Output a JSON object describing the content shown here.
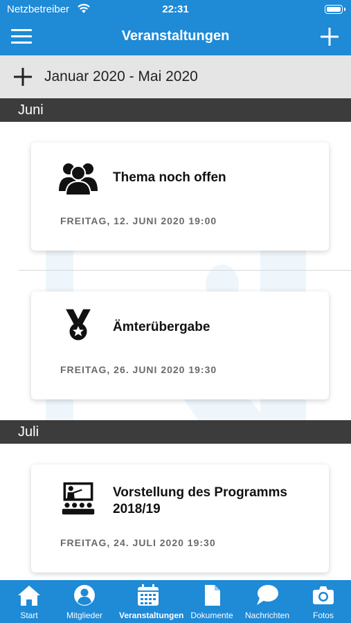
{
  "status": {
    "carrier": "Netzbetreiber",
    "time": "22:31"
  },
  "navbar": {
    "title": "Veranstaltungen"
  },
  "range": {
    "label": "Januar 2020 - Mai 2020"
  },
  "sections": [
    {
      "title": "Juni"
    },
    {
      "title": "Juli"
    }
  ],
  "events": [
    {
      "title": "Thema noch offen",
      "date": "FREITAG, 12. JUNI 2020 19:00",
      "icon": "group-icon"
    },
    {
      "title": "Ämterübergabe",
      "date": "FREITAG, 26. JUNI 2020 19:30",
      "icon": "medal-icon"
    },
    {
      "title_line1": "Vorstellung des Programms",
      "title_line2": "2018/19",
      "date": "FREITAG, 24. JULI 2020 19:30",
      "icon": "presentation-icon"
    }
  ],
  "tabs": [
    {
      "label": "Start",
      "icon": "home-icon"
    },
    {
      "label": "Mitglieder",
      "icon": "user-icon"
    },
    {
      "label": "Veranstaltungen",
      "icon": "calendar-icon",
      "active": true
    },
    {
      "label": "Dokumente",
      "icon": "document-icon"
    },
    {
      "label": "Nachrichten",
      "icon": "chat-icon"
    },
    {
      "label": "Fotos",
      "icon": "camera-icon"
    }
  ],
  "colors": {
    "primary": "#1f8ad6",
    "section": "#3c3c3c",
    "range_bg": "#e5e5e5"
  }
}
